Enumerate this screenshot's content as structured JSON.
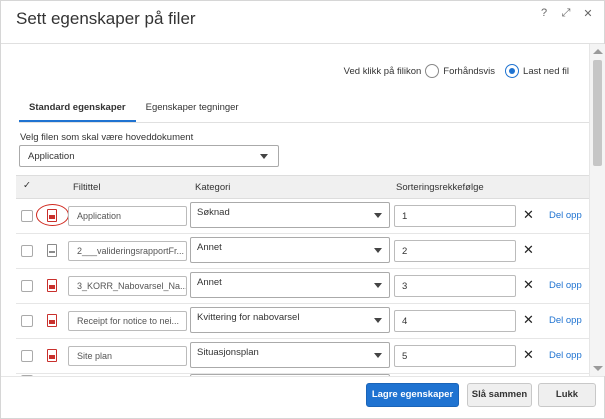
{
  "dialog": {
    "title": "Sett egenskaper på filer",
    "help_glyph": "?",
    "expand_glyph": "⤢",
    "close_glyph": "✕"
  },
  "click_option": {
    "label": "Ved klikk på filikon",
    "options": [
      {
        "label": "Forhåndsvis",
        "checked": false
      },
      {
        "label": "Last ned fil",
        "checked": true
      }
    ]
  },
  "tabs": [
    {
      "label": "Standard egenskaper",
      "active": true
    },
    {
      "label": "Egenskaper tegninger",
      "active": false
    }
  ],
  "main_doc": {
    "label": "Velg filen som skal være hoveddokument",
    "value": "Application"
  },
  "table": {
    "check_header": "✓",
    "headers": {
      "filename": "Filtittel",
      "category": "Kategori",
      "sort": "Sorteringsrekkefølge"
    },
    "delete_glyph": "✕",
    "rows": [
      {
        "icon": "pdf-icon",
        "filename": "Application",
        "category": "Søknad",
        "sort": "1",
        "delopp": "Del opp",
        "highlighted": true
      },
      {
        "icon": "xml-file-icon",
        "filename": "2___valideringsrapportFr...",
        "category": "Annet",
        "sort": "2",
        "delopp": "",
        "highlighted": false
      },
      {
        "icon": "pdf-icon",
        "filename": "3_KORR_Nabovarsel_Na...",
        "category": "Annet",
        "sort": "3",
        "delopp": "Del opp",
        "highlighted": false
      },
      {
        "icon": "pdf-icon",
        "filename": "Receipt for notice to nei...",
        "category": "Kvittering for nabovarsel",
        "sort": "4",
        "delopp": "Del opp",
        "highlighted": false
      },
      {
        "icon": "pdf-icon",
        "filename": "Site plan",
        "category": "Situasjonsplan",
        "sort": "5",
        "delopp": "Del opp",
        "highlighted": false
      }
    ]
  },
  "buttons": {
    "save": "Lagre egenskaper",
    "merge": "Slå sammen",
    "close": "Lukk"
  },
  "colors": {
    "accent": "#1f73d1",
    "pdf_red": "#c9302c",
    "annotation_red": "#d0271d"
  }
}
